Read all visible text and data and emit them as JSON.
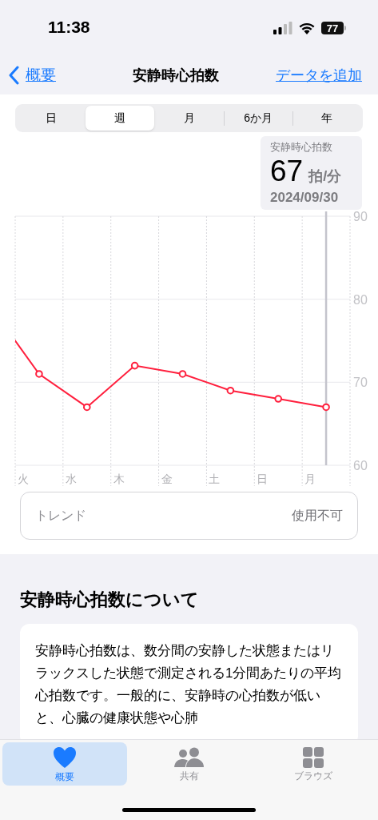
{
  "status_bar": {
    "time": "11:38",
    "battery": "77"
  },
  "nav": {
    "back": "概要",
    "title": "安静時心拍数",
    "action": "データを追加"
  },
  "segments": [
    {
      "label": "日",
      "selected": false
    },
    {
      "label": "週",
      "selected": true
    },
    {
      "label": "月",
      "selected": false
    },
    {
      "label": "6か月",
      "selected": false
    },
    {
      "label": "年",
      "selected": false
    }
  ],
  "callout": {
    "value": "67",
    "unit": "拍/分",
    "date": "2024/09/30"
  },
  "chart_data": {
    "type": "line",
    "categories": [
      null,
      "火",
      "水",
      "木",
      "金",
      "土",
      "日",
      "月"
    ],
    "ylim": [
      60,
      90
    ],
    "yticks": [
      60,
      70,
      80,
      90
    ],
    "series": [
      {
        "name": "安静時心拍数",
        "color": "#ff1f3d",
        "marker": "circle",
        "values": [
          79,
          71,
          67,
          72,
          71,
          69,
          68,
          67
        ]
      }
    ]
  },
  "trend": {
    "label": "トレンド",
    "value": "使用不可"
  },
  "about": {
    "heading": "安静時心拍数について",
    "body": "安静時心拍数は、数分間の安静した状態またはリラックスした状態で測定される1分間あたりの平均心拍数です。一般的に、安静時の心拍数が低いと、心臓の健康状態や心肺"
  },
  "tabs": [
    {
      "label": "概要",
      "kind": "heart",
      "selected": true
    },
    {
      "label": "共有",
      "kind": "people",
      "selected": false
    },
    {
      "label": "ブラウズ",
      "kind": "grid",
      "selected": false
    }
  ]
}
